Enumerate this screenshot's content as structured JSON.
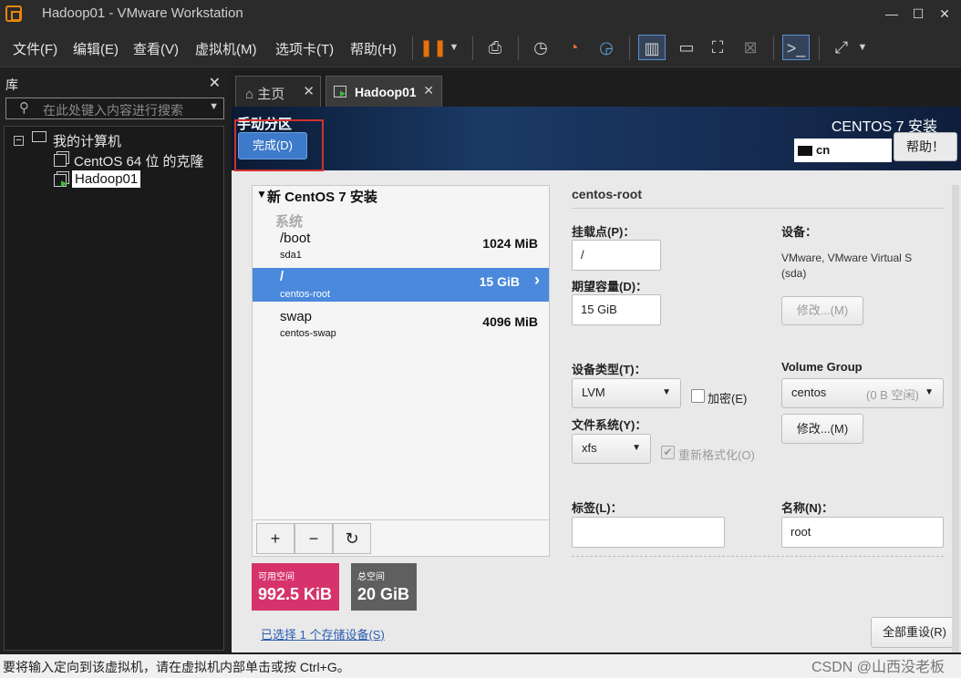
{
  "window": {
    "title": "Hadoop01 - VMware Workstation"
  },
  "menu": [
    "文件(F)",
    "编辑(E)",
    "查看(V)",
    "虚拟机(M)",
    "选项卡(T)",
    "帮助(H)"
  ],
  "library": {
    "header": "库",
    "search_placeholder": "在此处键入内容进行搜索",
    "tree": {
      "root": "我的计算机",
      "items": [
        "CentOS 64 位 的克隆",
        "Hadoop01"
      ]
    }
  },
  "tabs": [
    {
      "label": "主页"
    },
    {
      "label": "Hadoop01"
    }
  ],
  "installer": {
    "header": "手动分区",
    "done": "完成(D)",
    "product": "CENTOS 7 安装",
    "keyboard": "cn",
    "help": "帮助！",
    "section_title": "新 CentOS 7 安装",
    "system_label": "系统",
    "partitions": [
      {
        "mount": "/boot",
        "device": "sda1",
        "size": "1024 MiB"
      },
      {
        "mount": "/",
        "device": "centos-root",
        "size": "15 GiB"
      },
      {
        "mount": "swap",
        "device": "centos-swap",
        "size": "4096 MiB"
      }
    ],
    "available": {
      "label": "可用空间",
      "value": "992.5 KiB"
    },
    "total": {
      "label": "总空间",
      "value": "20 GiB"
    },
    "storage_link": "已选择 1 个存储设备(S)",
    "reset": "全部重设(R)",
    "detail": {
      "title": "centos-root",
      "mount_label": "挂载点(P)：",
      "mount_value": "/",
      "capacity_label": "期望容量(D)：",
      "capacity_value": "15 GiB",
      "device_label": "设备：",
      "device_desc": "VMware, VMware Virtual S (sda)",
      "modify": "修改...(M)",
      "type_label": "设备类型(T)：",
      "type_value": "LVM",
      "encrypt": "加密(E)",
      "vg_label": "Volume Group",
      "vg_name": "centos",
      "vg_free": "(0 B 空闲)",
      "vg_modify": "修改...(M)",
      "fs_label": "文件系统(Y)：",
      "fs_value": "xfs",
      "reformat": "重新格式化(O)",
      "label_label": "标签(L)：",
      "name_label": "名称(N)：",
      "name_value": "root"
    }
  },
  "status": "要将输入定向到该虚拟机，请在虚拟机内部单击或按 Ctrl+G。",
  "watermark": "CSDN @山西没老板",
  "colors": {
    "accent": "#4a89dc",
    "available": "#d6336c",
    "total": "#5f5f5f",
    "highlight": "#d32f2f"
  }
}
